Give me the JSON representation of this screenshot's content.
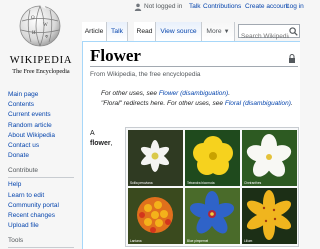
{
  "personal": {
    "not_logged_in": "Not logged in",
    "talk": "Talk",
    "contributions": "Contributions",
    "create_account": "Create account",
    "login": "Log in"
  },
  "logo": {
    "wordmark": "WIKIPEDIA",
    "tagline": "The Free Encyclopedia"
  },
  "sidebar": {
    "nav": [
      "Main page",
      "Contents",
      "Current events",
      "Random article",
      "About Wikipedia",
      "Contact us",
      "Donate"
    ],
    "contribute_heading": "Contribute",
    "contribute": [
      "Help",
      "Learn to edit",
      "Community portal",
      "Recent changes",
      "Upload file"
    ],
    "tools_heading": "Tools"
  },
  "tabs": {
    "article": "Article",
    "talk": "Talk",
    "read": "Read",
    "view_source": "View source",
    "more": "More"
  },
  "search": {
    "placeholder": "Search Wikipedia"
  },
  "article": {
    "title": "Flower",
    "from": "From Wikipedia, the free encyclopedia",
    "hatnote1_pre": "For other uses, see ",
    "hatnote1_link": "Flower (disambiguation)",
    "hatnote1_post": ".",
    "hatnote2_pre": "\"Floral\" redirects here. For other uses, see ",
    "hatnote2_link": "Floral (disambiguation)",
    "hatnote2_post": ".",
    "lead_a": "A",
    "lead_bold": "flower",
    "lead_comma": ","
  },
  "gallery": {
    "captions": [
      "Scilla peruviana",
      "Tetrandra bicornuta",
      "Cheiranthes",
      "Lantana",
      "Blue pimpernel",
      "Lilium"
    ]
  }
}
